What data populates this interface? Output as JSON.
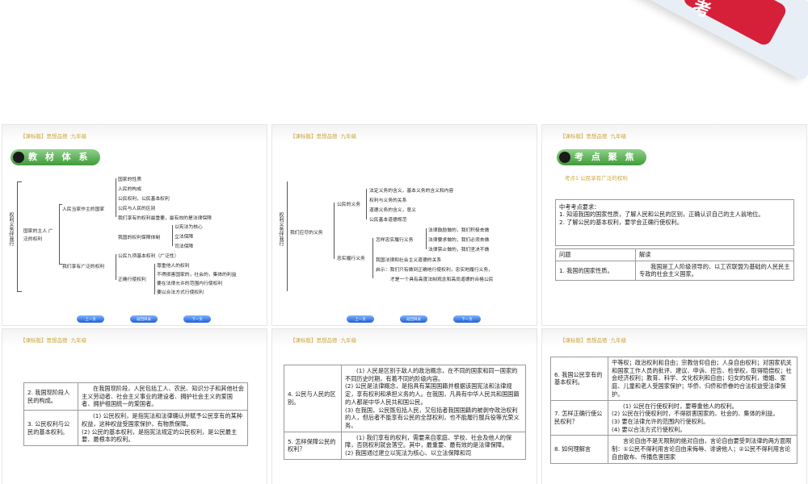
{
  "top_logo": {
    "text": "考"
  },
  "nav_buttons": [
    "上一页",
    "返回目录",
    "下一页"
  ],
  "slide1": {
    "header": "【课标版】思想品德 ·九年级",
    "badge": "教 材 体 系",
    "tree": {
      "root": "权利义务伴我行",
      "b1": "国家的主人 广泛的权利",
      "b1_c1": "人民当家作主的国家",
      "b1_c1_items": [
        "国家的性质",
        "人民的构成",
        "公民权利，公民基本权利",
        "公民与人民的区别",
        "我们享有的权利最重要，最有效的是法律保障"
      ],
      "b1_c2": "我国的权利保障体制",
      "b1_c2_items": [
        "以宪法为核心",
        "立法保障",
        "司法保障"
      ],
      "b2": "我们享有广泛的权利",
      "b2_items": [
        "公民九项基本权利（广泛性）"
      ],
      "b2_c1": "正确行使权利",
      "b2_c1_items": [
        "尊重他人的权利",
        "不得损害国家的，社会的，集体的利益",
        "要在法律允许的范围内行使权利",
        "要以合法方式行使权利"
      ]
    }
  },
  "slide2": {
    "header": "【课标版】思想品德 ·九年级",
    "tree": {
      "root": "权利义务伴我行",
      "b1": "我们应尽的义务",
      "c1": "公民的义务",
      "c1_items": [
        "法定义务的含义，基本义务的含义和内容",
        "权利与义务的关系",
        "道德义务的含义，意义",
        "公民基本道德规范"
      ],
      "c2": "忠实履行义务",
      "c2_sub": "怎样忠实履行义务",
      "c2_sub_items": [
        "法律鼓励做的，我们积极去做",
        "法律要求做的，我们必须去做",
        "法律禁止做的，我们坚决不做"
      ],
      "c2_items": [
        "我国法律和社会主义道德的关系",
        "启示：我们只有做到正确地行使权利，忠实地履行义务，",
        "才是一个具有高度法制观念和高尚道德的合格公民"
      ]
    }
  },
  "slide3": {
    "header": "【课标版】思想品德 ·九年级",
    "badge": "考 点 聚 焦",
    "topic": "考点1    公民享有广泛的权利",
    "requirements": {
      "title": "中考考点要求：",
      "items": [
        "1. 知道我国的国家性质，了解人民和公民的区别，正确认识自己的主人翁地位。",
        "2. 了解公民的基本权利，要学会正确行使权利。"
      ]
    },
    "table": {
      "header": [
        "问题",
        "解读"
      ],
      "rows": [
        [
          "1. 我国的国家性质。",
          "我国是工人阶级领导的、以工农联盟为基础的人民民主专政的社会主义国家。"
        ]
      ]
    }
  },
  "slide4": {
    "header": "【课标版】思想品德 ·九年级",
    "rows": [
      [
        "2. 我国现阶段人民的构成。",
        "在我国现阶段，人民包括工人、农民、知识分子和其他社会主义劳动者、社会主义事业的建设者、拥护社会主义的爱国者、拥护祖国统一的爱国者。"
      ],
      [
        "3. 公民权利与公民的基本权利。",
        "(1) 公民权利，是指宪法和法律确认并赋予公民享有的某种权益，这种权益受国家保护，有物质保障。\n(2) 公民的基本权利，是指宪法规定的公民权利，是公民最主要、最根本的权利。"
      ]
    ]
  },
  "slide5": {
    "header": "【课标版】思想品德 ·九年级",
    "rows": [
      [
        "4. 公民与人民的区别。",
        "(1) 人民是区别于敌人的政治概念，在不同的国家和同一国家的不同历史时期，有着不同的阶级内容。\n(2) 公民是法律概念，是指具有某国国籍并根据该国宪法和法律规定，享有权利和承担义务的人。在我国，凡具有中华人民共和国国籍的人都是中华人民共和国公民。\n(3) 在我国，公民既包括人民，又包括者我国国籍的被剥夺政治权利的人，但后者不能享有公民的全部权利，也不能履行服兵役等光荣义务。"
      ],
      [
        "5. 怎样保障公民的权利？",
        "(1) 我们享有的权利，需要来自家庭、学校、社会及他人的保障，否则权利就会落空。其中，最重要、最有效的是法律保障。\n(2) 我国通过建立以宪法为核心、以立法保障和司"
      ]
    ]
  },
  "slide6": {
    "header": "【课标版】思想品德 ·九年级",
    "rows": [
      [
        "6. 我国公民享有的基本权利。",
        "平等权；政治权利和自由；宗教信仰自由；人身自由权利；对国家机关和国家工作人员的批评、建议、申诉、控告、检举权，取得赔偿权；社会经济权利；教育、科学、文化权利和自由；妇女的权利，婚姻、家庭、儿童和老人受国家保护；华侨、归侨和侨眷的合法权益受法律保护。"
      ],
      [
        "7. 怎样正确行使公民权利？",
        "(1) 公民在行使权利时，要尊重他人的权利。\n(2) 公民在行使权利时，不得损害国家的、社会的、集体的利益。\n(3) 要在法律允许的范围内行使权利。\n(4) 要以合法方式行使权利。"
      ],
      [
        "8. 如何理解言",
        "言论自由不是无限制的绝对自由，言论自由要受到法律的两方面限制：①公民不得利用言论自由来侮辱、诽谤他人；②公民不得利用言论自由散布、传播危害国家"
      ]
    ]
  }
}
